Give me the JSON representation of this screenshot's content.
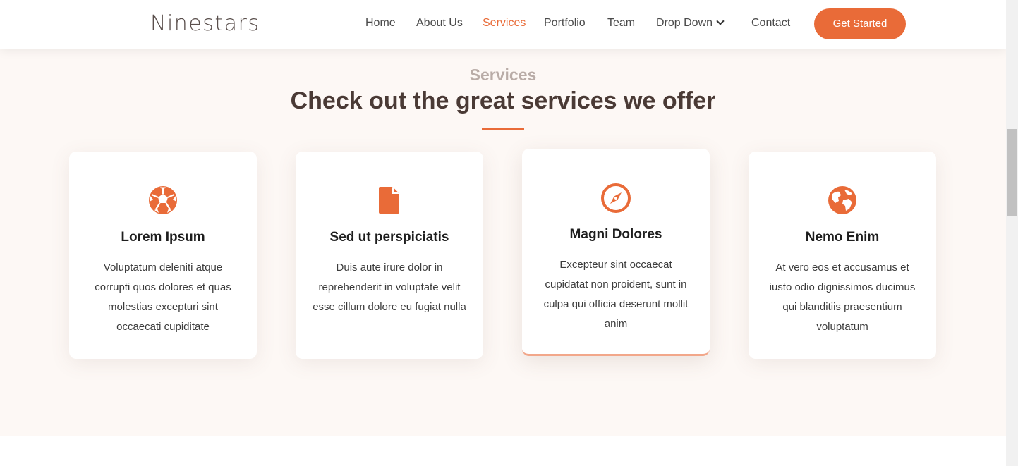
{
  "header": {
    "logo": "Ninestars",
    "nav": [
      {
        "label": "Home",
        "active": false
      },
      {
        "label": "About Us",
        "active": false
      },
      {
        "label": "Services",
        "active": true
      },
      {
        "label": "Portfolio",
        "active": false
      },
      {
        "label": "Team",
        "active": false
      },
      {
        "label": "Drop Down",
        "active": false,
        "has_dropdown": true
      },
      {
        "label": "Contact",
        "active": false
      }
    ],
    "cta_label": "Get Started"
  },
  "services": {
    "label": "Services",
    "title": "Check out the great services we offer",
    "cards": [
      {
        "icon": "soccer-ball-icon",
        "title": "Lorem Ipsum",
        "text": "Voluptatum deleniti atque corrupti quos dolores et quas molestias excepturi sint occaecati cupiditate"
      },
      {
        "icon": "file-icon",
        "title": "Sed ut perspiciatis",
        "text": "Duis aute irure dolor in reprehenderit in voluptate velit esse cillum dolore eu fugiat nulla"
      },
      {
        "icon": "compass-icon",
        "title": "Magni Dolores",
        "text": "Excepteur sint occaecat cupidatat non proident, sunt in culpa qui officia deserunt mollit anim"
      },
      {
        "icon": "globe-icon",
        "title": "Nemo Enim",
        "text": "At vero eos et accusamus et iusto odio dignissimos ducimus qui blanditiis praesentium voluptatum"
      }
    ]
  },
  "colors": {
    "accent": "#e96b38",
    "section_bg": "#fdf8f5",
    "heading": "#4a3a35",
    "muted_label": "#b9aca7"
  }
}
